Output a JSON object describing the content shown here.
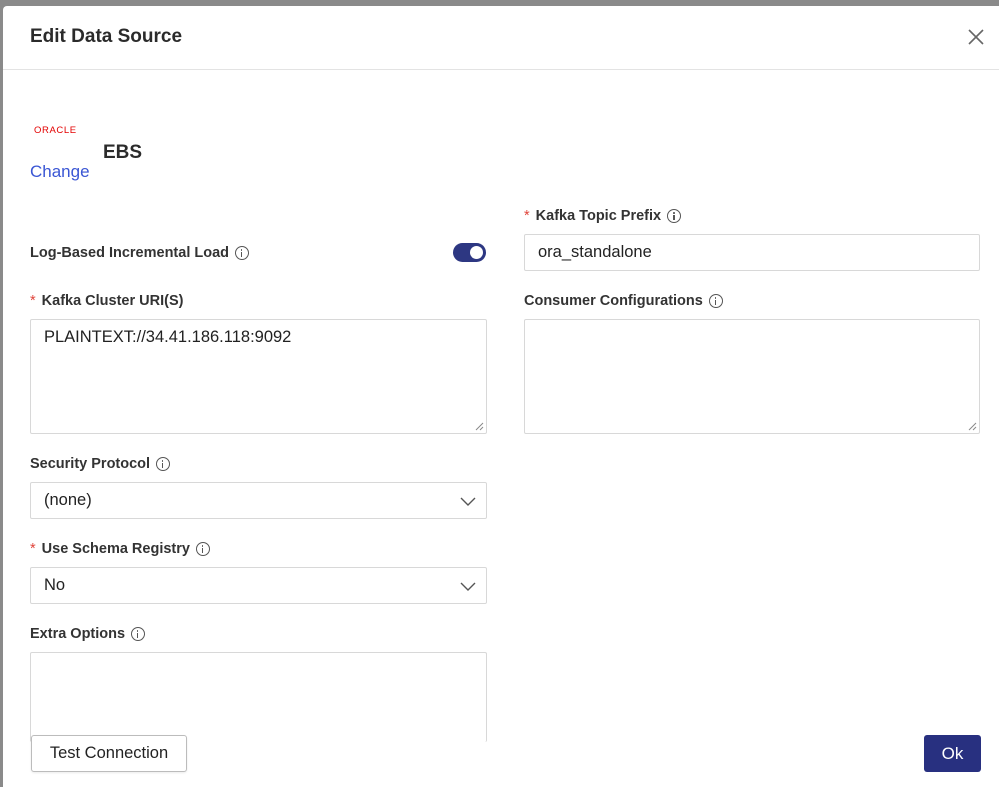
{
  "dialog": {
    "title": "Edit Data Source"
  },
  "source": {
    "logo_text": "ORACLE",
    "change_label": "Change",
    "name": "EBS"
  },
  "fields": {
    "log_based": {
      "label": "Log-Based Incremental Load",
      "enabled": true
    },
    "kafka_cluster": {
      "label": "Kafka Cluster URI(S)",
      "required": "*",
      "value": "PLAINTEXT://34.41.186.118:9092"
    },
    "security_protocol": {
      "label": "Security Protocol",
      "value": "(none)"
    },
    "schema_registry": {
      "label": "Use Schema Registry",
      "required": "*",
      "value": "No"
    },
    "extra_options": {
      "label": "Extra Options",
      "value": ""
    },
    "kafka_topic_prefix": {
      "label": "Kafka Topic Prefix",
      "required": "*",
      "value": "ora_standalone"
    },
    "consumer_config": {
      "label": "Consumer Configurations",
      "value": ""
    }
  },
  "footer": {
    "test_label": "Test Connection",
    "ok_label": "Ok"
  },
  "colors": {
    "accent": "#283080",
    "link": "#3a56d4",
    "required": "#e0443a",
    "oracle_red": "#e30000"
  }
}
